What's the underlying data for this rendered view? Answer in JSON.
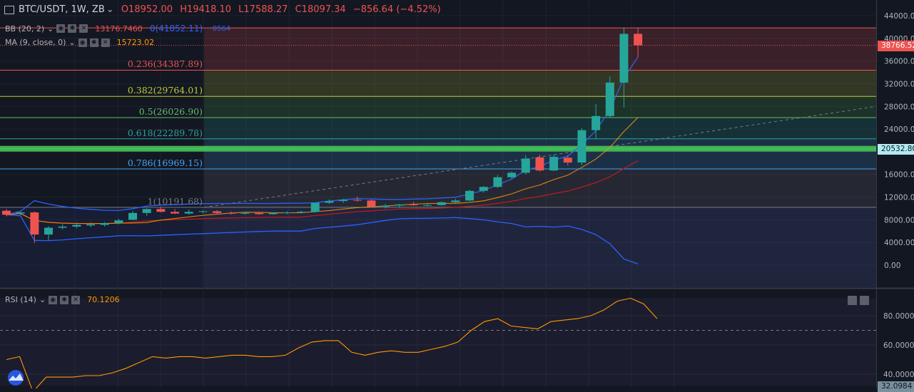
{
  "header": {
    "symbol": "BTC/USDT, 1W, ZB",
    "open": "O18952.00",
    "high": "H19418.10",
    "low": "L17588.27",
    "close": "C18097.34",
    "change": "−856.64 (−4.52%)"
  },
  "indicators": {
    "bb": {
      "label": "BB (20, 2)",
      "value1": "13176.7460",
      "value2": "0(41852.11)",
      "value3": "·· 0564"
    },
    "ma": {
      "label": "MA (9, close, 0)",
      "value": "15723.02"
    },
    "rsi": {
      "label": "RSI (14)",
      "value": "70.1206"
    }
  },
  "fib_levels": [
    {
      "label": "0.236(34387.89)",
      "price": 34387.89,
      "color": "#ef5350"
    },
    {
      "label": "0.382(29764.01)",
      "price": 29764.01,
      "color": "#c0ca33"
    },
    {
      "label": "0.5(26026.90)",
      "price": 26026.9,
      "color": "#66bb6a"
    },
    {
      "label": "0.618(22289.78)",
      "price": 22289.78,
      "color": "#26a69a"
    },
    {
      "label": "0.786(16969.15)",
      "price": 16969.15,
      "color": "#42a5f5"
    },
    {
      "label": "1(10191.68)",
      "price": 10191.68,
      "color": "#787b86"
    }
  ],
  "price_axis": {
    "ticks": [
      "44000.00",
      "40000.00",
      "36000.00",
      "32000.00",
      "28000.00",
      "24000.00",
      "20000.00",
      "16000.00",
      "12000.00",
      "8000.00",
      "4000.00",
      "0.00"
    ],
    "tick_values": [
      44000,
      40000,
      36000,
      32000,
      28000,
      24000,
      20000,
      16000,
      12000,
      8000,
      4000,
      0
    ],
    "current_price_label": "38766.52",
    "current_price": 38766.52,
    "level_label": "20532.80",
    "level_price": 20532.8
  },
  "rsi_axis": {
    "ticks": [
      "80.0000",
      "60.0000",
      "40.0000"
    ],
    "tick_values": [
      80,
      60,
      40
    ],
    "bottom_label": "32.0984"
  },
  "colors": {
    "up": "#26a69a",
    "down": "#ef5350",
    "accent": "#2196f3",
    "ma": "#ff9800",
    "rsi": "#ff9800"
  },
  "chart_data": {
    "type": "candlestick",
    "candles": [
      {
        "o": 9600,
        "h": 9900,
        "l": 8600,
        "c": 8900
      },
      {
        "o": 9100,
        "h": 9500,
        "l": 8800,
        "c": 9300
      },
      {
        "o": 9300,
        "h": 9500,
        "l": 3900,
        "c": 5400
      },
      {
        "o": 5400,
        "h": 6900,
        "l": 4400,
        "c": 6600
      },
      {
        "o": 6600,
        "h": 7200,
        "l": 6300,
        "c": 6800
      },
      {
        "o": 6800,
        "h": 7500,
        "l": 6500,
        "c": 7100
      },
      {
        "o": 7000,
        "h": 7600,
        "l": 6700,
        "c": 7200
      },
      {
        "o": 7100,
        "h": 7600,
        "l": 6800,
        "c": 7400
      },
      {
        "o": 7400,
        "h": 8200,
        "l": 7200,
        "c": 7900
      },
      {
        "o": 8000,
        "h": 9600,
        "l": 7900,
        "c": 9200
      },
      {
        "o": 9200,
        "h": 10000,
        "l": 8700,
        "c": 9900
      },
      {
        "o": 9900,
        "h": 10300,
        "l": 9300,
        "c": 9400
      },
      {
        "o": 9400,
        "h": 9900,
        "l": 9000,
        "c": 9100
      },
      {
        "o": 9100,
        "h": 9800,
        "l": 8900,
        "c": 9400
      },
      {
        "o": 9400,
        "h": 9700,
        "l": 9100,
        "c": 9500
      },
      {
        "o": 9500,
        "h": 9700,
        "l": 9000,
        "c": 9200
      },
      {
        "o": 9200,
        "h": 9500,
        "l": 8900,
        "c": 9100
      },
      {
        "o": 9100,
        "h": 9400,
        "l": 8900,
        "c": 9200
      },
      {
        "o": 9200,
        "h": 9300,
        "l": 8900,
        "c": 9000
      },
      {
        "o": 9000,
        "h": 9300,
        "l": 8900,
        "c": 9200
      },
      {
        "o": 9200,
        "h": 9500,
        "l": 9000,
        "c": 9300
      },
      {
        "o": 9300,
        "h": 9600,
        "l": 9100,
        "c": 9400
      },
      {
        "o": 9400,
        "h": 11000,
        "l": 9300,
        "c": 11000
      },
      {
        "o": 11000,
        "h": 11600,
        "l": 10800,
        "c": 11300
      },
      {
        "o": 11300,
        "h": 11700,
        "l": 11000,
        "c": 11500
      },
      {
        "o": 11500,
        "h": 12100,
        "l": 11200,
        "c": 11400
      },
      {
        "o": 11400,
        "h": 11600,
        "l": 10200,
        "c": 10300
      },
      {
        "o": 10300,
        "h": 10800,
        "l": 10000,
        "c": 10500
      },
      {
        "o": 10500,
        "h": 10800,
        "l": 10200,
        "c": 10700
      },
      {
        "o": 10700,
        "h": 11200,
        "l": 10500,
        "c": 10600
      },
      {
        "o": 10600,
        "h": 10900,
        "l": 10400,
        "c": 10600
      },
      {
        "o": 10600,
        "h": 11200,
        "l": 10500,
        "c": 11100
      },
      {
        "o": 11100,
        "h": 11700,
        "l": 10900,
        "c": 11400
      },
      {
        "o": 11400,
        "h": 13300,
        "l": 11300,
        "c": 13100
      },
      {
        "o": 13100,
        "h": 13900,
        "l": 12800,
        "c": 13800
      },
      {
        "o": 13800,
        "h": 15900,
        "l": 13600,
        "c": 15500
      },
      {
        "o": 15500,
        "h": 16500,
        "l": 15200,
        "c": 16300
      },
      {
        "o": 16300,
        "h": 19400,
        "l": 16000,
        "c": 18800
      },
      {
        "o": 19000,
        "h": 19500,
        "l": 16500,
        "c": 16700
      },
      {
        "o": 16700,
        "h": 19500,
        "l": 16600,
        "c": 19100
      },
      {
        "o": 18950,
        "h": 19420,
        "l": 17590,
        "c": 18100
      },
      {
        "o": 18100,
        "h": 24200,
        "l": 17600,
        "c": 23800
      },
      {
        "o": 23800,
        "h": 28400,
        "l": 22200,
        "c": 26300
      },
      {
        "o": 26300,
        "h": 33300,
        "l": 26000,
        "c": 32200
      },
      {
        "o": 32200,
        "h": 41900,
        "l": 27800,
        "c": 40800
      },
      {
        "o": 40800,
        "h": 41900,
        "l": 36700,
        "c": 38766
      }
    ],
    "rsi": [
      50,
      52,
      28,
      38,
      38,
      38,
      39,
      39,
      41,
      44,
      48,
      52,
      51,
      52,
      52,
      51,
      52,
      53,
      53,
      52,
      52,
      53,
      58,
      62,
      63,
      63,
      55,
      53,
      55,
      56,
      55,
      55,
      57,
      59,
      62,
      70,
      76,
      78,
      73,
      72,
      71,
      76,
      77,
      78,
      80,
      84,
      90,
      92,
      88,
      78
    ],
    "price_range": [
      0,
      44000
    ],
    "rsi_range": [
      32,
      92
    ],
    "fib_high": 41852.11,
    "fib_low": 10191.68
  }
}
